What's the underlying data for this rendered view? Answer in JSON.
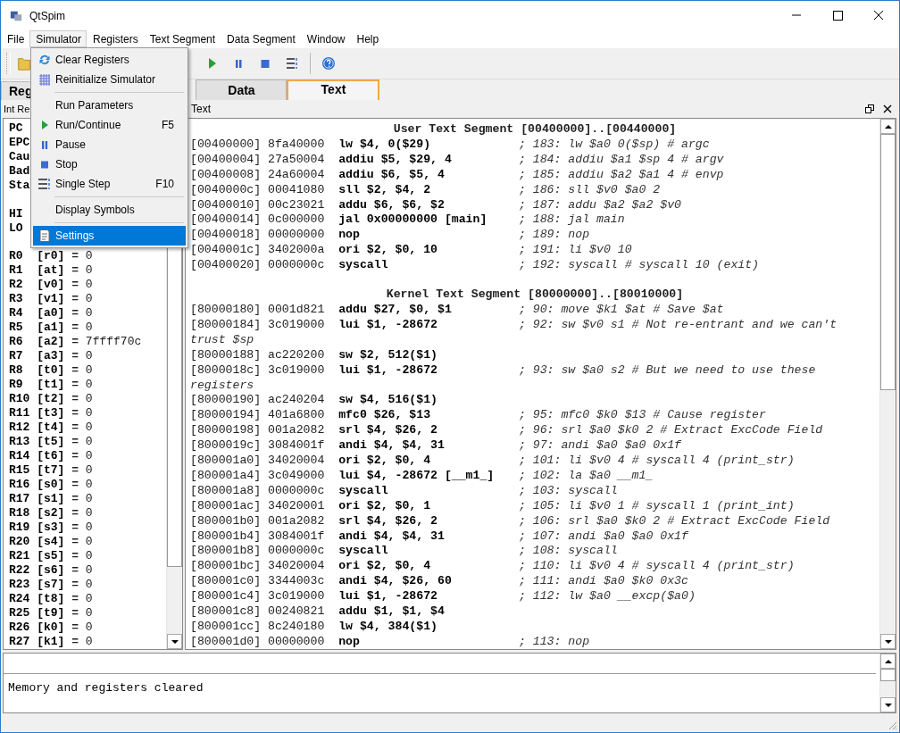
{
  "window": {
    "title": "QtSpim"
  },
  "menu_bar": [
    {
      "label": "File",
      "selected": false
    },
    {
      "label": "Simulator",
      "selected": true
    },
    {
      "label": "Registers",
      "selected": false
    },
    {
      "label": "Text Segment",
      "selected": false
    },
    {
      "label": "Data Segment",
      "selected": false
    },
    {
      "label": "Window",
      "selected": false
    },
    {
      "label": "Help",
      "selected": false
    }
  ],
  "simulator_menu": [
    {
      "kind": "item",
      "label": "Clear Registers",
      "selected": false
    },
    {
      "kind": "item",
      "label": "Reinitialize Simulator",
      "selected": false
    },
    {
      "kind": "separator"
    },
    {
      "kind": "item",
      "label": "Run Parameters",
      "selected": false
    },
    {
      "kind": "item",
      "label": "Run/Continue",
      "shortcut": "F5",
      "selected": false
    },
    {
      "kind": "item",
      "label": "Pause",
      "selected": false
    },
    {
      "kind": "item",
      "label": "Stop",
      "selected": false
    },
    {
      "kind": "item",
      "label": "Single Step",
      "shortcut": "F10",
      "selected": false
    },
    {
      "kind": "separator"
    },
    {
      "kind": "item",
      "label": "Display Symbols",
      "selected": false
    },
    {
      "kind": "separator"
    },
    {
      "kind": "item",
      "label": "Settings",
      "selected": true
    }
  ],
  "register_tab": {
    "label": "Reg"
  },
  "segment_tabs": [
    {
      "label": "Data",
      "selected": false
    },
    {
      "label": "Text",
      "selected": true
    }
  ],
  "dock_titles": {
    "registers": "Int Re",
    "text": "Text"
  },
  "register_groups": [
    [
      {
        "name": "PC"
      },
      {
        "name": "EPC"
      },
      {
        "name": "Cau"
      },
      {
        "name": "Bad"
      },
      {
        "name": "Sta"
      }
    ],
    [
      {
        "name": "HI"
      },
      {
        "name": "LO"
      }
    ],
    [
      {
        "name": "R0",
        "alias": "[r0]",
        "value": "**=** 0"
      },
      {
        "name": "R1",
        "alias": "[at]",
        "value": "**=** 0"
      },
      {
        "name": "R2",
        "alias": "[v0]",
        "value": "**=** 0"
      },
      {
        "name": "R3",
        "alias": "[v1]",
        "value": "**=** 0"
      },
      {
        "name": "R4",
        "alias": "[a0]",
        "value": "**=** 0"
      },
      {
        "name": "R5",
        "alias": "[a1]",
        "value": "**=** 0"
      },
      {
        "name": "R6",
        "alias": "[a2]",
        "value": "**=** 7ffff70c"
      },
      {
        "name": "R7",
        "alias": "[a3]",
        "value": "**=** 0"
      },
      {
        "name": "R8",
        "alias": "[t0]",
        "value": "**=** 0"
      },
      {
        "name": "R9",
        "alias": "[t1]",
        "value": "**=** 0"
      },
      {
        "name": "R10",
        "alias": "[t2]",
        "value": "**=** 0"
      },
      {
        "name": "R11",
        "alias": "[t3]",
        "value": "**=** 0"
      },
      {
        "name": "R12",
        "alias": "[t4]",
        "value": "**=** 0"
      },
      {
        "name": "R13",
        "alias": "[t5]",
        "value": "**=** 0"
      },
      {
        "name": "R14",
        "alias": "[t6]",
        "value": "**=** 0"
      },
      {
        "name": "R15",
        "alias": "[t7]",
        "value": "**=** 0"
      },
      {
        "name": "R16",
        "alias": "[s0]",
        "value": "**=** 0"
      },
      {
        "name": "R17",
        "alias": "[s1]",
        "value": "**=** 0"
      },
      {
        "name": "R18",
        "alias": "[s2]",
        "value": "**=** 0"
      },
      {
        "name": "R19",
        "alias": "[s3]",
        "value": "**=** 0"
      },
      {
        "name": "R20",
        "alias": "[s4]",
        "value": "**=** 0"
      },
      {
        "name": "R21",
        "alias": "[s5]",
        "value": "**=** 0"
      },
      {
        "name": "R22",
        "alias": "[s6]",
        "value": "**=** 0"
      },
      {
        "name": "R23",
        "alias": "[s7]",
        "value": "**=** 0"
      },
      {
        "name": "R24",
        "alias": "[t8]",
        "value": "**=** 0"
      },
      {
        "name": "R25",
        "alias": "[t9]",
        "value": "**=** 0"
      },
      {
        "name": "R26",
        "alias": "[k0]",
        "value": "**=** 0"
      },
      {
        "name": "R27",
        "alias": "[k1]",
        "value": "**=** 0"
      }
    ]
  ],
  "segments": [
    {
      "header": "User Text Segment [00400000]..[00440000]",
      "lines": [
        {
          "address": "[00400000]",
          "word": "8fa40000",
          "instruction": "lw $4, 0($29)",
          "comment": "; 183: lw $a0 0($sp) # argc"
        },
        {
          "address": "[00400004]",
          "word": "27a50004",
          "instruction": "addiu $5, $29, 4",
          "comment": "; 184: addiu $a1 $sp 4 # argv"
        },
        {
          "address": "[00400008]",
          "word": "24a60004",
          "instruction": "addiu $6, $5, 4",
          "comment": "; 185: addiu $a2 $a1 4 # envp"
        },
        {
          "address": "[0040000c]",
          "word": "00041080",
          "instruction": "sll $2, $4, 2",
          "comment": "; 186: sll $v0 $a0 2"
        },
        {
          "address": "[00400010]",
          "word": "00c23021",
          "instruction": "addu $6, $6, $2",
          "comment": "; 187: addu $a2 $a2 $v0"
        },
        {
          "address": "[00400014]",
          "word": "0c000000",
          "instruction": "jal 0x00000000 [main]",
          "comment": "; 188: jal main"
        },
        {
          "address": "[00400018]",
          "word": "00000000",
          "instruction": "nop",
          "comment": "; 189: nop"
        },
        {
          "address": "[0040001c]",
          "word": "3402000a",
          "instruction": "ori $2, $0, 10",
          "comment": "; 191: li $v0 10"
        },
        {
          "address": "[00400020]",
          "word": "0000000c",
          "instruction": "syscall",
          "comment": "; 192: syscall # syscall 10 (exit)"
        }
      ]
    },
    {
      "header": "Kernel Text Segment [80000000]..[80010000]",
      "lines": [
        {
          "address": "[80000180]",
          "word": "0001d821",
          "instruction": "addu $27, $0, $1",
          "comment": "; 90: move $k1 $at # Save $at"
        },
        {
          "address": "[80000184]",
          "word": "3c019000",
          "instruction": "lui $1, -28672",
          "comment": "; 92: sw $v0 s1 # Not re-entrant and we can't",
          "comment_wrap": "trust $sp"
        },
        {
          "address": "[80000188]",
          "word": "ac220200",
          "instruction": "sw $2, 512($1)"
        },
        {
          "address": "[8000018c]",
          "word": "3c019000",
          "instruction": "lui $1, -28672",
          "comment": "; 93: sw $a0 s2 # But we need to use these",
          "comment_wrap": "registers"
        },
        {
          "address": "[80000190]",
          "word": "ac240204",
          "instruction": "sw $4, 516($1)"
        },
        {
          "address": "[80000194]",
          "word": "401a6800",
          "instruction": "mfc0 $26, $13",
          "comment": "; 95: mfc0 $k0 $13 # Cause register"
        },
        {
          "address": "[80000198]",
          "word": "001a2082",
          "instruction": "srl $4, $26, 2",
          "comment": "; 96: srl $a0 $k0 2 # Extract ExcCode Field"
        },
        {
          "address": "[8000019c]",
          "word": "3084001f",
          "instruction": "andi $4, $4, 31",
          "comment": "; 97: andi $a0 $a0 0x1f"
        },
        {
          "address": "[800001a0]",
          "word": "34020004",
          "instruction": "ori $2, $0, 4",
          "comment": "; 101: li $v0 4 # syscall 4 (print_str)"
        },
        {
          "address": "[800001a4]",
          "word": "3c049000",
          "instruction": "lui $4, -28672 [__m1_]",
          "comment": "; 102: la $a0 __m1_"
        },
        {
          "address": "[800001a8]",
          "word": "0000000c",
          "instruction": "syscall",
          "comment": "; 103: syscall"
        },
        {
          "address": "[800001ac]",
          "word": "34020001",
          "instruction": "ori $2, $0, 1",
          "comment": "; 105: li $v0 1 # syscall 1 (print_int)"
        },
        {
          "address": "[800001b0]",
          "word": "001a2082",
          "instruction": "srl $4, $26, 2",
          "comment": "; 106: srl $a0 $k0 2 # Extract ExcCode Field"
        },
        {
          "address": "[800001b4]",
          "word": "3084001f",
          "instruction": "andi $4, $4, 31",
          "comment": "; 107: andi $a0 $a0 0x1f"
        },
        {
          "address": "[800001b8]",
          "word": "0000000c",
          "instruction": "syscall",
          "comment": "; 108: syscall"
        },
        {
          "address": "[800001bc]",
          "word": "34020004",
          "instruction": "ori $2, $0, 4",
          "comment": "; 110: li $v0 4 # syscall 4 (print_str)"
        },
        {
          "address": "[800001c0]",
          "word": "3344003c",
          "instruction": "andi $4, $26, 60",
          "comment": "; 111: andi $a0 $k0 0x3c"
        },
        {
          "address": "[800001c4]",
          "word": "3c019000",
          "instruction": "lui $1, -28672",
          "comment": "; 112: lw $a0 __excp($a0)"
        },
        {
          "address": "[800001c8]",
          "word": "00240821",
          "instruction": "addu $1, $1, $4"
        },
        {
          "address": "[800001cc]",
          "word": "8c240180",
          "instruction": "lw $4, 384($1)"
        },
        {
          "address": "[800001d0]",
          "word": "00000000",
          "instruction": "nop",
          "comment": "; 113: nop"
        }
      ]
    }
  ],
  "console": {
    "message": "Memory and registers cleared"
  }
}
